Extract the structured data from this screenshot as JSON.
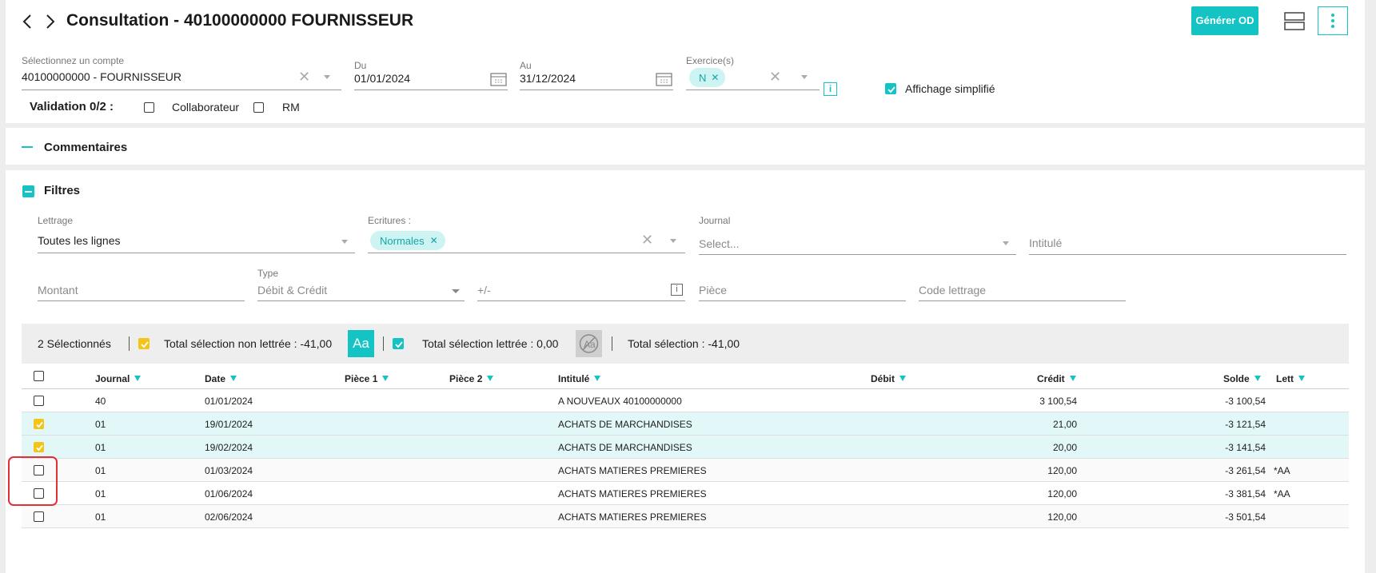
{
  "header": {
    "title": "Consultation - 40100000000 FOURNISSEUR",
    "generate_label": "Générer OD"
  },
  "account": {
    "label": "Sélectionnez un compte",
    "value": "40100000000 - FOURNISSEUR"
  },
  "date_from": {
    "label": "Du",
    "value": "01/01/2024"
  },
  "date_to": {
    "label": "Au",
    "value": "31/12/2024"
  },
  "exercise": {
    "label": "Exercice(s)",
    "chip": "N"
  },
  "simplified": {
    "label": "Affichage simplifié",
    "checked": true
  },
  "validation": {
    "label": "Validation 0/2 :",
    "collaborator": "Collaborateur",
    "rm": "RM"
  },
  "comments": {
    "title": "Commentaires"
  },
  "filters": {
    "title": "Filtres",
    "lettrage": {
      "label": "Lettrage",
      "value": "Toutes les lignes"
    },
    "ecritures": {
      "label": "Ecritures :",
      "chip": "Normales"
    },
    "journal": {
      "label": "Journal",
      "placeholder": "Select..."
    },
    "intitule": {
      "placeholder": "Intitulé"
    },
    "montant": {
      "placeholder": "Montant"
    },
    "type": {
      "label": "Type",
      "value": "Débit & Crédit"
    },
    "plusminus": {
      "placeholder": "+/-"
    },
    "piece": {
      "placeholder": "Pièce"
    },
    "code_lettrage": {
      "placeholder": "Code lettrage"
    }
  },
  "selection": {
    "count": "2 Sélectionnés",
    "non_lettree": "Total sélection non lettrée : -41,00",
    "aa": "Aa",
    "lettree": "Total sélection lettrée : 0,00",
    "total": "Total sélection : -41,00"
  },
  "table": {
    "columns": {
      "journal": "Journal",
      "date": "Date",
      "piece1": "Pièce 1",
      "piece2": "Pièce 2",
      "intitule": "Intitulé",
      "debit": "Débit",
      "credit": "Crédit",
      "solde": "Solde",
      "lett": "Lett"
    },
    "rows": [
      {
        "journal": "40",
        "date": "01/01/2024",
        "intitule": "A NOUVEAUX 40100000000",
        "debit": "",
        "credit": "3 100,54",
        "solde": "-3 100,54",
        "lett": "",
        "selected": false
      },
      {
        "journal": "01",
        "date": "19/01/2024",
        "intitule": "ACHATS DE MARCHANDISES",
        "debit": "",
        "credit": "21,00",
        "solde": "-3 121,54",
        "lett": "",
        "selected": true
      },
      {
        "journal": "01",
        "date": "19/02/2024",
        "intitule": "ACHATS DE MARCHANDISES",
        "debit": "",
        "credit": "20,00",
        "solde": "-3 141,54",
        "lett": "",
        "selected": true
      },
      {
        "journal": "01",
        "date": "01/03/2024",
        "intitule": "ACHATS MATIERES PREMIERES",
        "debit": "",
        "credit": "120,00",
        "solde": "-3 261,54",
        "lett": "*AA",
        "selected": false
      },
      {
        "journal": "01",
        "date": "01/06/2024",
        "intitule": "ACHATS MATIERES PREMIERES",
        "debit": "",
        "credit": "120,00",
        "solde": "-3 381,54",
        "lett": "*AA",
        "selected": false
      },
      {
        "journal": "01",
        "date": "02/06/2024",
        "intitule": "ACHATS MATIERES PREMIERES",
        "debit": "",
        "credit": "120,00",
        "solde": "-3 501,54",
        "lett": "",
        "selected": false
      }
    ]
  },
  "colors": {
    "accent": "#14c4c4",
    "selected_row": "#e2f7f7",
    "selected_check": "#f4c518",
    "highlight_box": "#e0313a"
  }
}
